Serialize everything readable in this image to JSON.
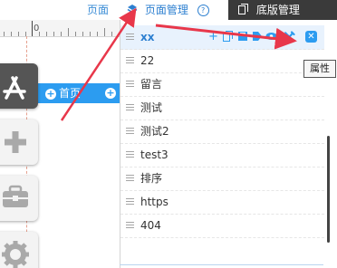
{
  "canvas": {
    "tab_label": "页面",
    "ruler_number": "0",
    "nav_items": [
      "首页"
    ]
  },
  "tabs": [
    {
      "label": "页面管理",
      "icon": "layers-icon",
      "active": true
    },
    {
      "label": "底版管理",
      "icon": "copy-icon",
      "active": false
    }
  ],
  "help_icon": "?",
  "pages": [
    {
      "name": "xx",
      "selected": true
    },
    {
      "name": "22"
    },
    {
      "name": "留言"
    },
    {
      "name": "测试"
    },
    {
      "name": "测试2"
    },
    {
      "name": "test3"
    },
    {
      "name": "排序"
    },
    {
      "name": "https"
    },
    {
      "name": "404"
    }
  ],
  "row_actions": [
    "add-icon",
    "copy-page-icon",
    "save-icon",
    "tag-icon",
    "eye-icon",
    "settings-icon",
    "delete-icon"
  ],
  "tooltip": "属性",
  "tools": [
    "app-store-icon",
    "add-icon",
    "toolbox-icon",
    "settings-gear-icon"
  ],
  "colors": {
    "accent": "#2c9cf0",
    "dark_tab": "#3a3a3a",
    "arrow": "#e8374a"
  }
}
